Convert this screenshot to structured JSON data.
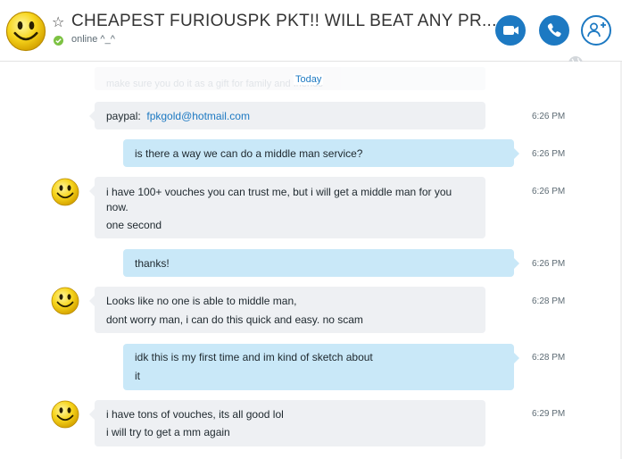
{
  "header": {
    "title": "CHEAPEST FURIOUSPK PKT!! WILL BEAT ANY PR...",
    "status": "online ^_^",
    "favorite_icon": "star-outline-icon",
    "buttons": [
      {
        "name": "video-call",
        "icon": "video-camera-icon"
      },
      {
        "name": "voice-call",
        "icon": "phone-icon"
      },
      {
        "name": "add-people",
        "icon": "add-person-icon"
      }
    ],
    "accent_color": "#1d79c2",
    "online_color": "#7dc243"
  },
  "chat": {
    "faded_text": "make sure you do it as a gift for family and friends",
    "date_divider": "Today",
    "messages": [
      {
        "direction": "received",
        "label": "paypal:",
        "link": "fpkgold@hotmail.com",
        "time": "6:26 PM"
      },
      {
        "direction": "sent",
        "lines": [
          "is there a way we can do a middle man service?"
        ],
        "time": "6:26 PM"
      },
      {
        "direction": "received",
        "lines": [
          "i have 100+ vouches you can trust me, but i will get a middle man for you",
          "now.",
          "one second"
        ],
        "time": "6:26 PM"
      },
      {
        "direction": "sent",
        "lines": [
          "thanks!"
        ],
        "time": "6:26 PM"
      },
      {
        "direction": "received",
        "lines": [
          "Looks like no one is able to middle man,",
          "dont worry man, i can do this quick and easy. no scam"
        ],
        "time": "6:28 PM"
      },
      {
        "direction": "sent",
        "lines": [
          "idk this is my first time and im kind of sketch about",
          "it"
        ],
        "time": "6:28 PM"
      },
      {
        "direction": "received",
        "lines": [
          "i have tons of vouches, its all good lol",
          "i will try to get a mm again"
        ],
        "time": "6:29 PM"
      }
    ]
  },
  "colors": {
    "received_bubble": "#eef0f3",
    "sent_bubble": "#c9e8f8",
    "link": "#1d79c2",
    "timestamp": "#5d6b74"
  }
}
